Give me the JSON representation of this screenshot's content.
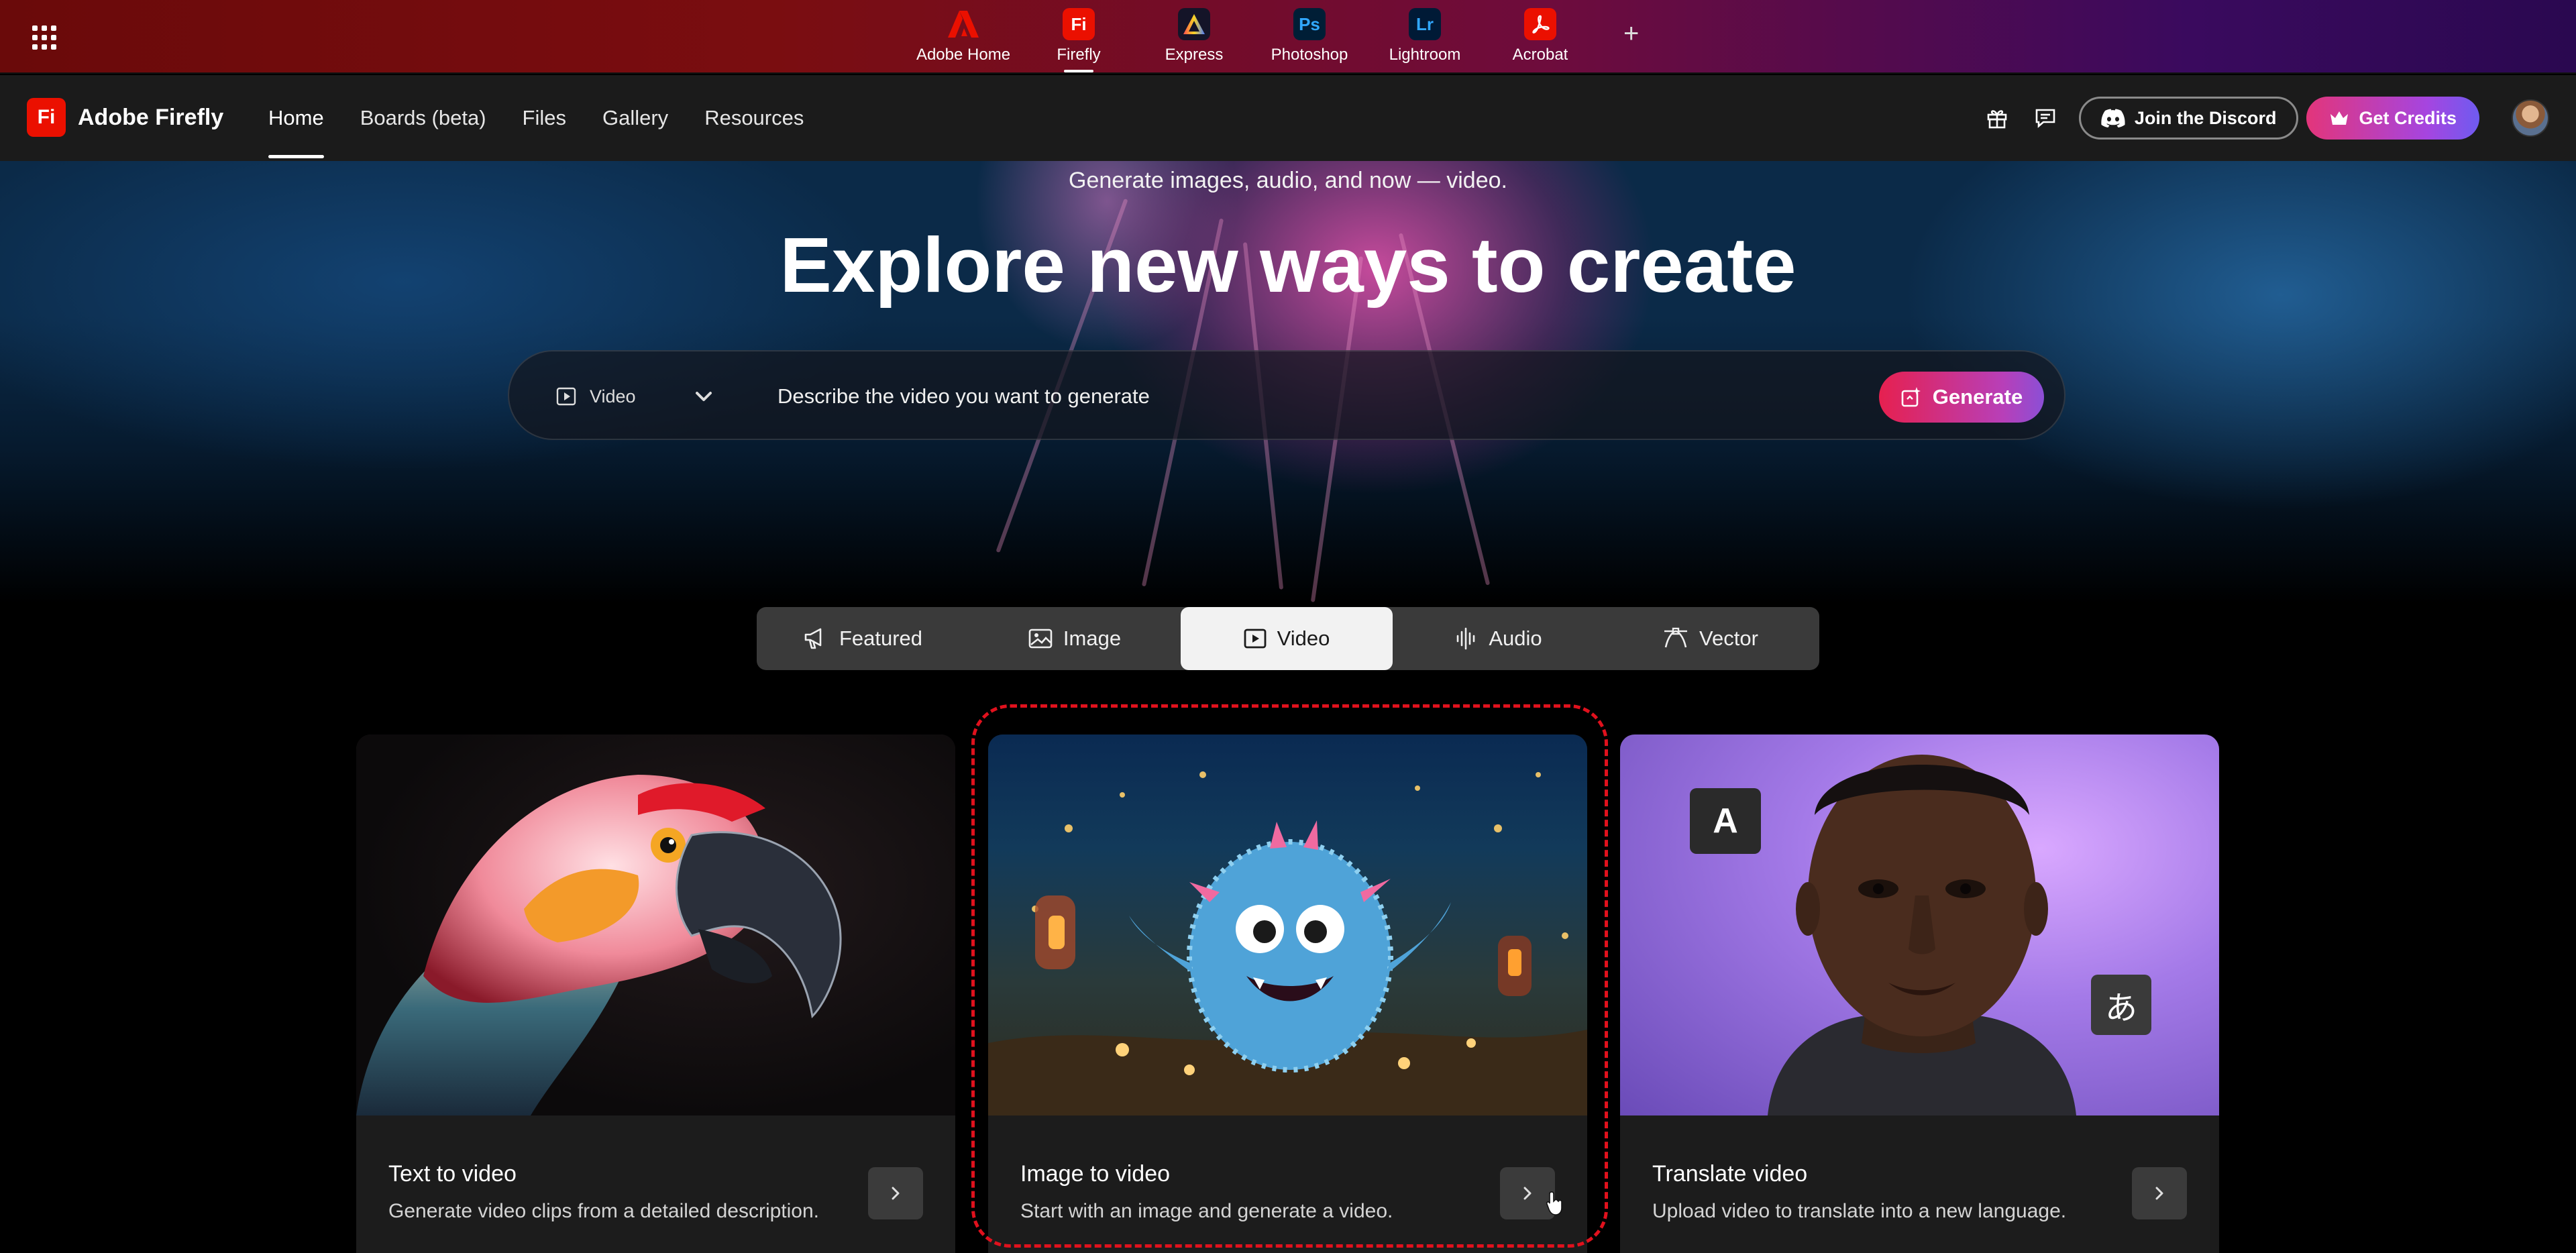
{
  "appbar": {
    "apps": [
      {
        "label": "Adobe Home",
        "icon": "adobe-logo-icon",
        "color": "#eb1000"
      },
      {
        "label": "Firefly",
        "tile": "Fi",
        "color": "#eb1000"
      },
      {
        "label": "Express",
        "icon": "express-logo-icon",
        "color": "#1a1a2e"
      },
      {
        "label": "Photoshop",
        "tile": "Ps",
        "color": "#001e36"
      },
      {
        "label": "Lightroom",
        "tile": "Lr",
        "color": "#001a36"
      },
      {
        "label": "Acrobat",
        "icon": "acrobat-logo-icon",
        "color": "#eb1000"
      }
    ],
    "active_app": "Firefly",
    "add_symbol": "+"
  },
  "nav": {
    "brand_tile": "Fi",
    "brand_name": "Adobe Firefly",
    "links": [
      "Home",
      "Boards (beta)",
      "Files",
      "Gallery",
      "Resources"
    ],
    "active_link": "Home",
    "discord_label": "Join the Discord",
    "credits_label": "Get Credits"
  },
  "hero": {
    "subtitle": "Generate images, audio, and now — video.",
    "title": "Explore new ways to create",
    "mode": "Video",
    "prompt_placeholder": "Describe the video you want to generate",
    "generate_label": "Generate"
  },
  "tabs": {
    "items": [
      {
        "label": "Featured",
        "icon": "megaphone-icon"
      },
      {
        "label": "Image",
        "icon": "image-icon"
      },
      {
        "label": "Video",
        "icon": "video-play-icon"
      },
      {
        "label": "Audio",
        "icon": "audio-wave-icon"
      },
      {
        "label": "Vector",
        "icon": "vector-pen-icon"
      }
    ],
    "active": "Video"
  },
  "cards": [
    {
      "title": "Text to video",
      "description": "Generate video clips from a detailed description."
    },
    {
      "title": "Image to video",
      "description": "Start with an image and generate a video."
    },
    {
      "title": "Translate video",
      "description": "Upload video to translate into a new language.",
      "badge_left": "A",
      "badge_right": "あ"
    }
  ],
  "colors": {
    "accent_red": "#eb1000",
    "highlight_dashed": "#e0111d"
  }
}
